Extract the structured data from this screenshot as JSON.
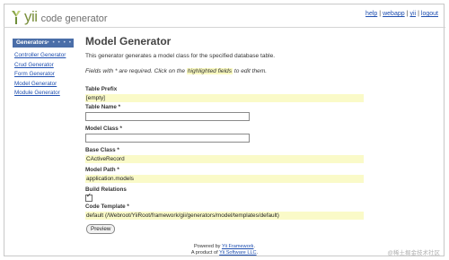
{
  "logo": {
    "word": "yii",
    "subtitle": "code generator"
  },
  "topnav": {
    "help": "help",
    "webapp": "webapp",
    "yii": "yii",
    "logout": "logout",
    "separator": "|"
  },
  "sidebar": {
    "heading": "Generators",
    "items": [
      {
        "label": "Controller Generator"
      },
      {
        "label": "Crud Generator"
      },
      {
        "label": "Form Generator"
      },
      {
        "label": "Model Generator"
      },
      {
        "label": "Module Generator"
      }
    ]
  },
  "main": {
    "title": "Model Generator",
    "description": "This generator generates a model class for the specified database table.",
    "note_prefix": "Fields with * are required. Click on the",
    "note_highlight": "highlighted fields",
    "note_suffix": "to edit them."
  },
  "form": {
    "table_prefix": {
      "label": "Table Prefix",
      "value": "[empty]"
    },
    "table_name": {
      "label": "Table Name *",
      "value": ""
    },
    "model_class": {
      "label": "Model Class *",
      "value": ""
    },
    "base_class": {
      "label": "Base Class *",
      "value": "CActiveRecord"
    },
    "model_path": {
      "label": "Model Path *",
      "value": "application.models"
    },
    "build_relations": {
      "label": "Build Relations",
      "checked": true,
      "mark": "✓"
    },
    "code_template": {
      "label": "Code Template *",
      "value": "default (/Webroot/YiiRoot/framework/gii/generators/model/templates/default)"
    },
    "preview_label": "Preview"
  },
  "footer": {
    "line1_prefix": "Powered by",
    "line1_link": "Yii Framework",
    "line1_suffix": ".",
    "line2_prefix": "A product of",
    "line2_link": "Yii Software LLC",
    "line2_suffix": "."
  },
  "watermark": "@稀土掘金技术社区",
  "colors": {
    "accent": "#4a6ea8",
    "link": "#1f4fb0",
    "highlight": "#fafac8",
    "logo_green": "#7a8f3c"
  }
}
